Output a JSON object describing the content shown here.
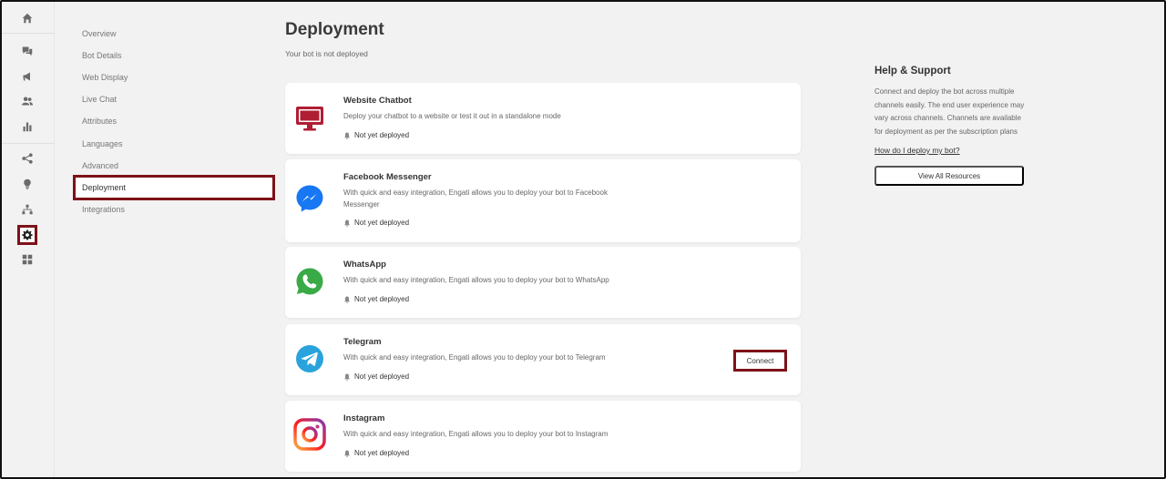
{
  "subnav": {
    "items": [
      {
        "label": "Overview"
      },
      {
        "label": "Bot Details"
      },
      {
        "label": "Web Display"
      },
      {
        "label": "Live Chat"
      },
      {
        "label": "Attributes"
      },
      {
        "label": "Languages"
      },
      {
        "label": "Advanced"
      },
      {
        "label": "Deployment",
        "active": true
      },
      {
        "label": "Integrations"
      }
    ]
  },
  "rail": {
    "icons": [
      "home-icon",
      "chat-icon",
      "megaphone-icon",
      "users-icon",
      "bar-chart-icon",
      "share-icon",
      "lightbulb-icon",
      "hierarchy-icon",
      "gear-icon",
      "grid-icon"
    ],
    "active": "gear-icon"
  },
  "main": {
    "title": "Deployment",
    "subtitle": "Your bot is not deployed",
    "cards": [
      {
        "title": "Website Chatbot",
        "desc": "Deploy your chatbot to a website or test it out in a standalone mode",
        "status": "Not yet deployed",
        "icon": "monitor-icon"
      },
      {
        "title": "Facebook Messenger",
        "desc": "With quick and easy integration, Engati allows you to deploy your bot to Facebook Messenger",
        "status": "Not yet deployed",
        "icon": "messenger-icon"
      },
      {
        "title": "WhatsApp",
        "desc": "With quick and easy integration, Engati allows you to deploy your bot to WhatsApp",
        "status": "Not yet deployed",
        "icon": "whatsapp-icon"
      },
      {
        "title": "Telegram",
        "desc": "With quick and easy integration, Engati allows you to deploy your bot to Telegram",
        "status": "Not yet deployed",
        "icon": "telegram-icon",
        "action": "Connect"
      },
      {
        "title": "Instagram",
        "desc": "With quick and easy integration, Engati allows you to deploy your bot to Instagram",
        "status": "Not yet deployed",
        "icon": "instagram-icon"
      }
    ]
  },
  "help": {
    "title": "Help & Support",
    "text": "Connect and deploy the bot across multiple channels easily. The end user experience may vary across channels. Channels are available for deployment as per the subscription plans",
    "link": "How do I deploy my bot?",
    "button": "View All Resources"
  },
  "colors": {
    "highlight": "#7d1218",
    "website": "#b01e34",
    "messenger": "#1877f2",
    "whatsapp": "#3aaa46",
    "telegram": "#2aa3dc"
  }
}
